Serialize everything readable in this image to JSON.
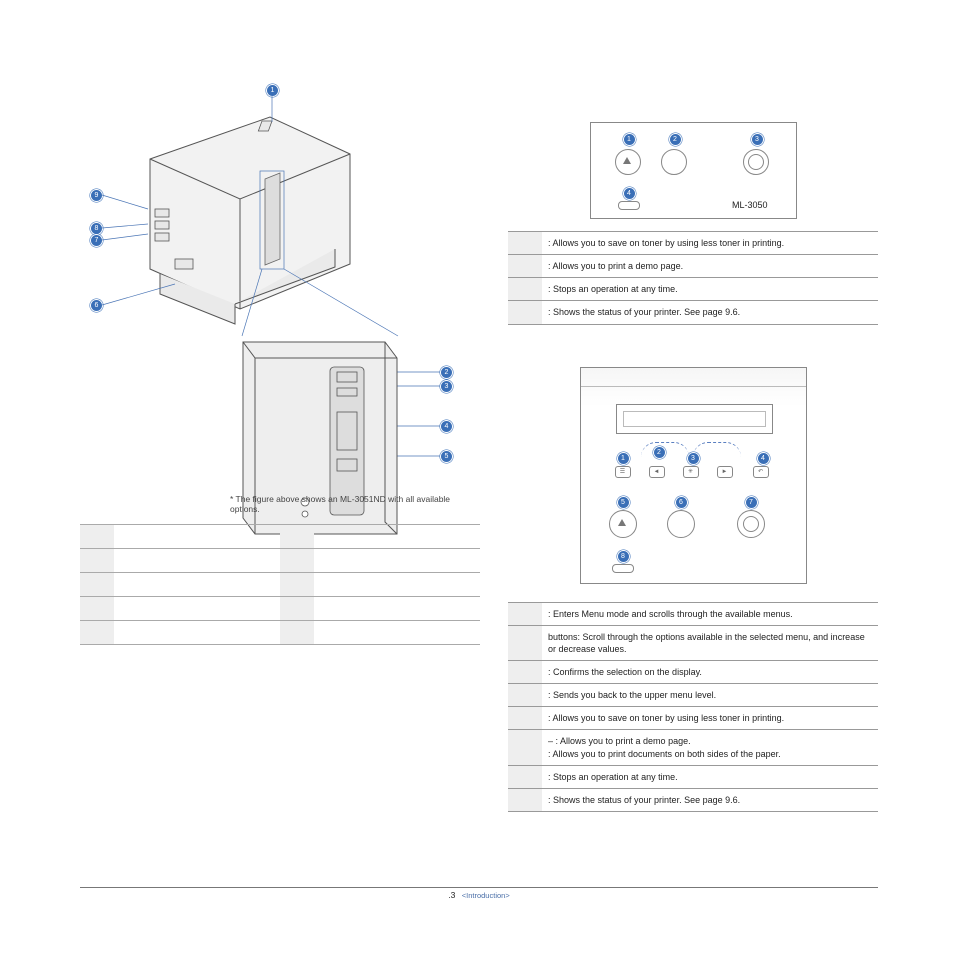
{
  "left": {
    "diagram_callouts": {
      "rear": [
        "1",
        "2",
        "3",
        "4",
        "5",
        "6",
        "7",
        "8",
        "9"
      ],
      "zoom": [
        "2",
        "3",
        "4",
        "5"
      ]
    },
    "caption": "The figure above shows an ML-3051ND with all available options.",
    "parts_rows": [
      [
        "",
        ""
      ],
      [
        "",
        ""
      ],
      [
        "",
        ""
      ],
      [
        "",
        ""
      ],
      [
        "",
        ""
      ]
    ]
  },
  "panel1": {
    "model_label": "ML-3050",
    "callouts": [
      "1",
      "2",
      "3",
      "4"
    ],
    "rows": [
      {
        "n": "",
        "text": ": Allows you to save on toner by using less toner in printing."
      },
      {
        "n": "",
        "text": ": Allows you to print a demo page."
      },
      {
        "n": "",
        "text": ": Stops an operation at any time."
      },
      {
        "n": "",
        "text": ": Shows the status of your printer. See page 9.6."
      }
    ]
  },
  "panel2": {
    "callouts": [
      "1",
      "2",
      "3",
      "4",
      "5",
      "6",
      "7",
      "8"
    ],
    "rows": [
      {
        "n": "",
        "text": ": Enters Menu mode and scrolls through the available menus."
      },
      {
        "n": "",
        "text": "buttons: Scroll through the options available in the selected menu, and increase or decrease values."
      },
      {
        "n": "",
        "text": ": Confirms the selection on the display."
      },
      {
        "n": "",
        "text": ": Sends you back to the upper menu level."
      },
      {
        "n": "",
        "text": ": Allows you to save on toner by using less toner in printing."
      },
      {
        "n": "",
        "text": "–       : Allows you to print a demo page.\n                 : Allows you to print documents on both sides of the paper."
      },
      {
        "n": "",
        "text": ": Stops an operation at any time."
      },
      {
        "n": "",
        "text": ": Shows the status of your printer. See page 9.6."
      }
    ]
  },
  "footer": {
    "page": ".3",
    "section": "<Introduction>"
  }
}
